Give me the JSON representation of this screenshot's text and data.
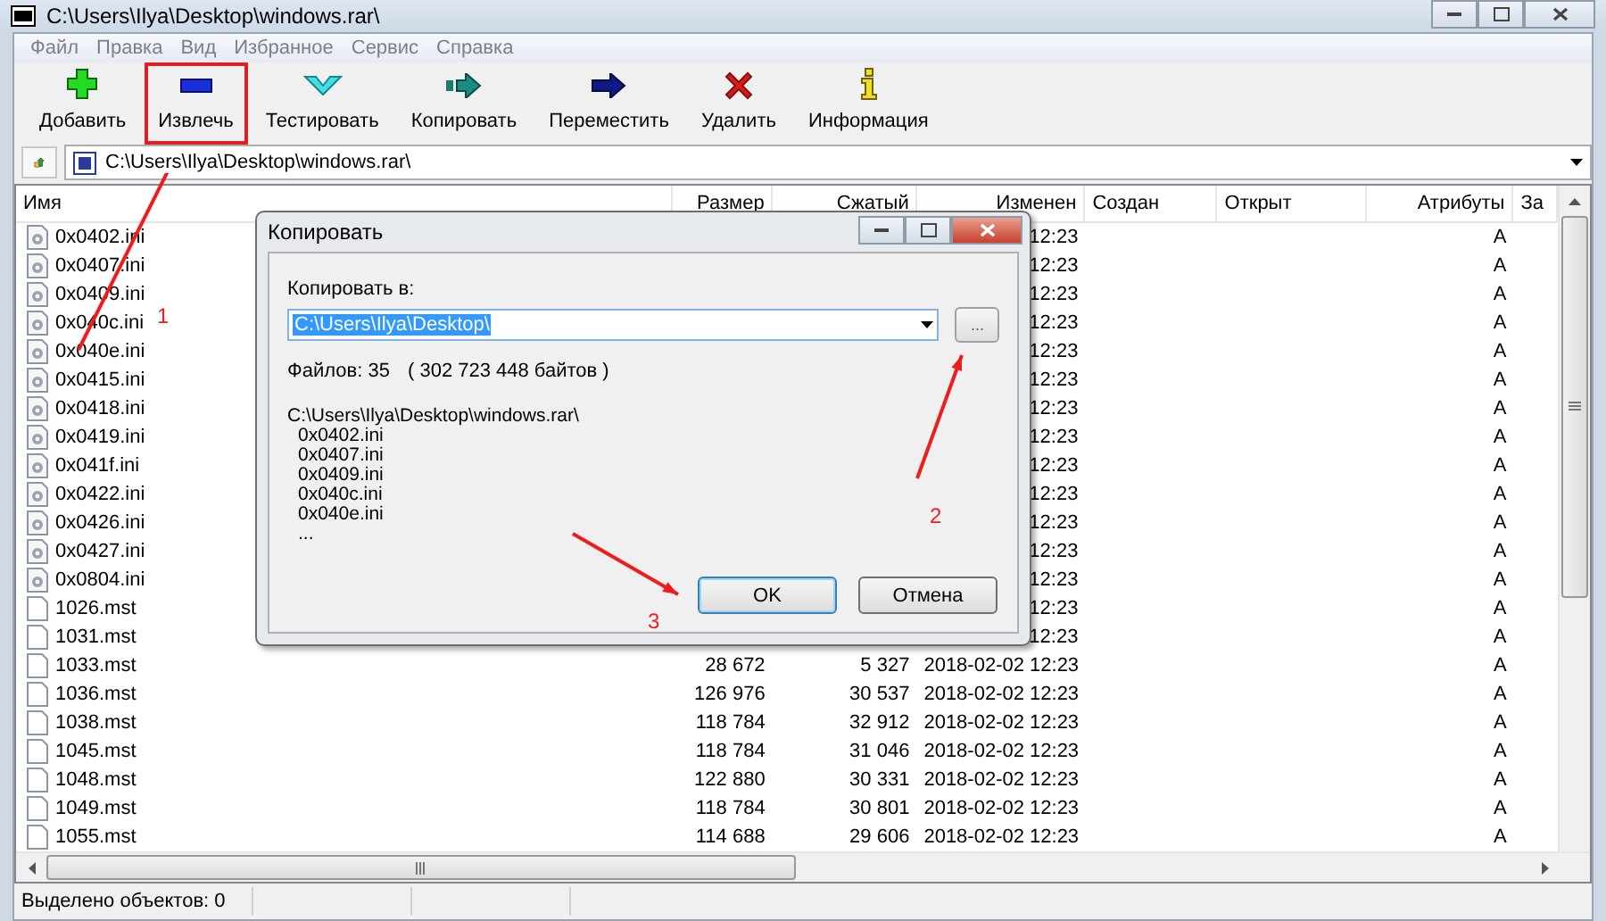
{
  "window": {
    "title": "C:\\Users\\Ilya\\Desktop\\windows.rar\\"
  },
  "menu": [
    "Файл",
    "Правка",
    "Вид",
    "Избранное",
    "Сервис",
    "Справка"
  ],
  "toolbar": [
    {
      "kind": "add",
      "label": "Добавить",
      "highlighted": false
    },
    {
      "kind": "extract",
      "label": "Извлечь",
      "highlighted": true
    },
    {
      "kind": "test",
      "label": "Тестировать",
      "highlighted": false
    },
    {
      "kind": "copy",
      "label": "Копировать",
      "highlighted": false
    },
    {
      "kind": "move",
      "label": "Переместить",
      "highlighted": false
    },
    {
      "kind": "delete",
      "label": "Удалить",
      "highlighted": false
    },
    {
      "kind": "info",
      "label": "Информация",
      "highlighted": false
    }
  ],
  "address": {
    "value": "C:\\Users\\Ilya\\Desktop\\windows.rar\\"
  },
  "table": {
    "columns": [
      "Имя",
      "Размер",
      "Сжатый",
      "Изменен",
      "Создан",
      "Открыт",
      "Атрибуты",
      "За"
    ],
    "rows": [
      {
        "kind": "config",
        "name": "0x0402.ini",
        "modified": "12:23",
        "attributes": "A"
      },
      {
        "kind": "config",
        "name": "0x0407.ini",
        "modified": "12:23",
        "attributes": "A"
      },
      {
        "kind": "config",
        "name": "0x0409.ini",
        "modified": "12:23",
        "attributes": "A"
      },
      {
        "kind": "config",
        "name": "0x040c.ini",
        "modified": "12:23",
        "attributes": "A"
      },
      {
        "kind": "config",
        "name": "0x040e.ini",
        "modified": "12:23",
        "attributes": "A"
      },
      {
        "kind": "config",
        "name": "0x0415.ini",
        "modified": "12:23",
        "attributes": "A"
      },
      {
        "kind": "config",
        "name": "0x0418.ini",
        "modified": "12:23",
        "attributes": "A"
      },
      {
        "kind": "config",
        "name": "0x0419.ini",
        "modified": "12:23",
        "attributes": "A"
      },
      {
        "kind": "config",
        "name": "0x041f.ini",
        "modified": "12:23",
        "attributes": "A"
      },
      {
        "kind": "config",
        "name": "0x0422.ini",
        "modified": "12:23",
        "attributes": "A"
      },
      {
        "kind": "config",
        "name": "0x0426.ini",
        "modified": "12:23",
        "attributes": "A"
      },
      {
        "kind": "config",
        "name": "0x0427.ini",
        "modified": "12:23",
        "attributes": "A"
      },
      {
        "kind": "config",
        "name": "0x0804.ini",
        "modified": "12:23",
        "attributes": "A"
      },
      {
        "kind": "plain",
        "name": "1026.mst",
        "modified": "12:23",
        "attributes": "A"
      },
      {
        "kind": "plain",
        "name": "1031.mst",
        "modified": "12:23",
        "attributes": "A"
      },
      {
        "kind": "plain",
        "name": "1033.mst",
        "size": "28 672",
        "packed": "5 327",
        "modified": "2018-02-02 12:23",
        "attributes": "A"
      },
      {
        "kind": "plain",
        "name": "1036.mst",
        "size": "126 976",
        "packed": "30 537",
        "modified": "2018-02-02 12:23",
        "attributes": "A"
      },
      {
        "kind": "plain",
        "name": "1038.mst",
        "size": "118 784",
        "packed": "32 912",
        "modified": "2018-02-02 12:23",
        "attributes": "A"
      },
      {
        "kind": "plain",
        "name": "1045.mst",
        "size": "118 784",
        "packed": "31 046",
        "modified": "2018-02-02 12:23",
        "attributes": "A"
      },
      {
        "kind": "plain",
        "name": "1048.mst",
        "size": "122 880",
        "packed": "30 331",
        "modified": "2018-02-02 12:23",
        "attributes": "A"
      },
      {
        "kind": "plain",
        "name": "1049.mst",
        "size": "118 784",
        "packed": "30 801",
        "modified": "2018-02-02 12:23",
        "attributes": "A"
      },
      {
        "kind": "plain",
        "name": "1055.mst",
        "size": "114 688",
        "packed": "29 606",
        "modified": "2018-02-02 12:23",
        "attributes": "A"
      }
    ]
  },
  "status_bar": {
    "text": "Выделено объектов: 0"
  },
  "dialog": {
    "title": "Копировать",
    "label": "Копировать в:",
    "value": "C:\\Users\\Ilya\\Desktop\\",
    "browse": "...",
    "files": "Файлов: 35",
    "bytes": "( 302 723 448 байтов )",
    "listing": [
      "C:\\Users\\Ilya\\Desktop\\windows.rar\\",
      "0x0402.ini",
      "0x0407.ini",
      "0x0409.ini",
      "0x040c.ini",
      "0x040e.ini",
      "..."
    ],
    "buttons": [
      {
        "label": "OK",
        "default": true
      },
      {
        "label": "Отмена",
        "default": false
      }
    ]
  },
  "annotations": [
    {
      "label": "1"
    },
    {
      "label": "2"
    },
    {
      "label": "3"
    }
  ]
}
